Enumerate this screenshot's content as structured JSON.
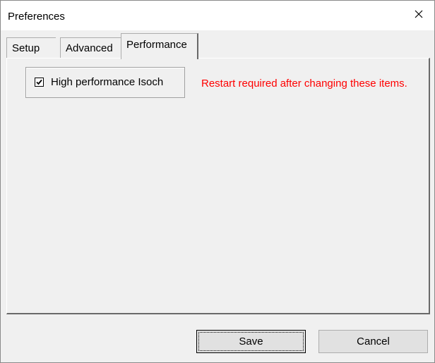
{
  "window": {
    "title": "Preferences"
  },
  "tabs": [
    {
      "label": "Setup"
    },
    {
      "label": "Advanced"
    },
    {
      "label": "Performance"
    }
  ],
  "active_tab": "Performance",
  "performance": {
    "checkbox_label": "High performance Isoch",
    "checkbox_checked": true,
    "restart_note": "Restart required after changing these items."
  },
  "buttons": {
    "save_label": "Save",
    "cancel_label": "Cancel"
  },
  "colors": {
    "note_color": "#ff0000",
    "dialog_bg": "#f0f0f0"
  },
  "icons": {
    "close": "close-icon",
    "checkmark": "checkmark-icon"
  }
}
